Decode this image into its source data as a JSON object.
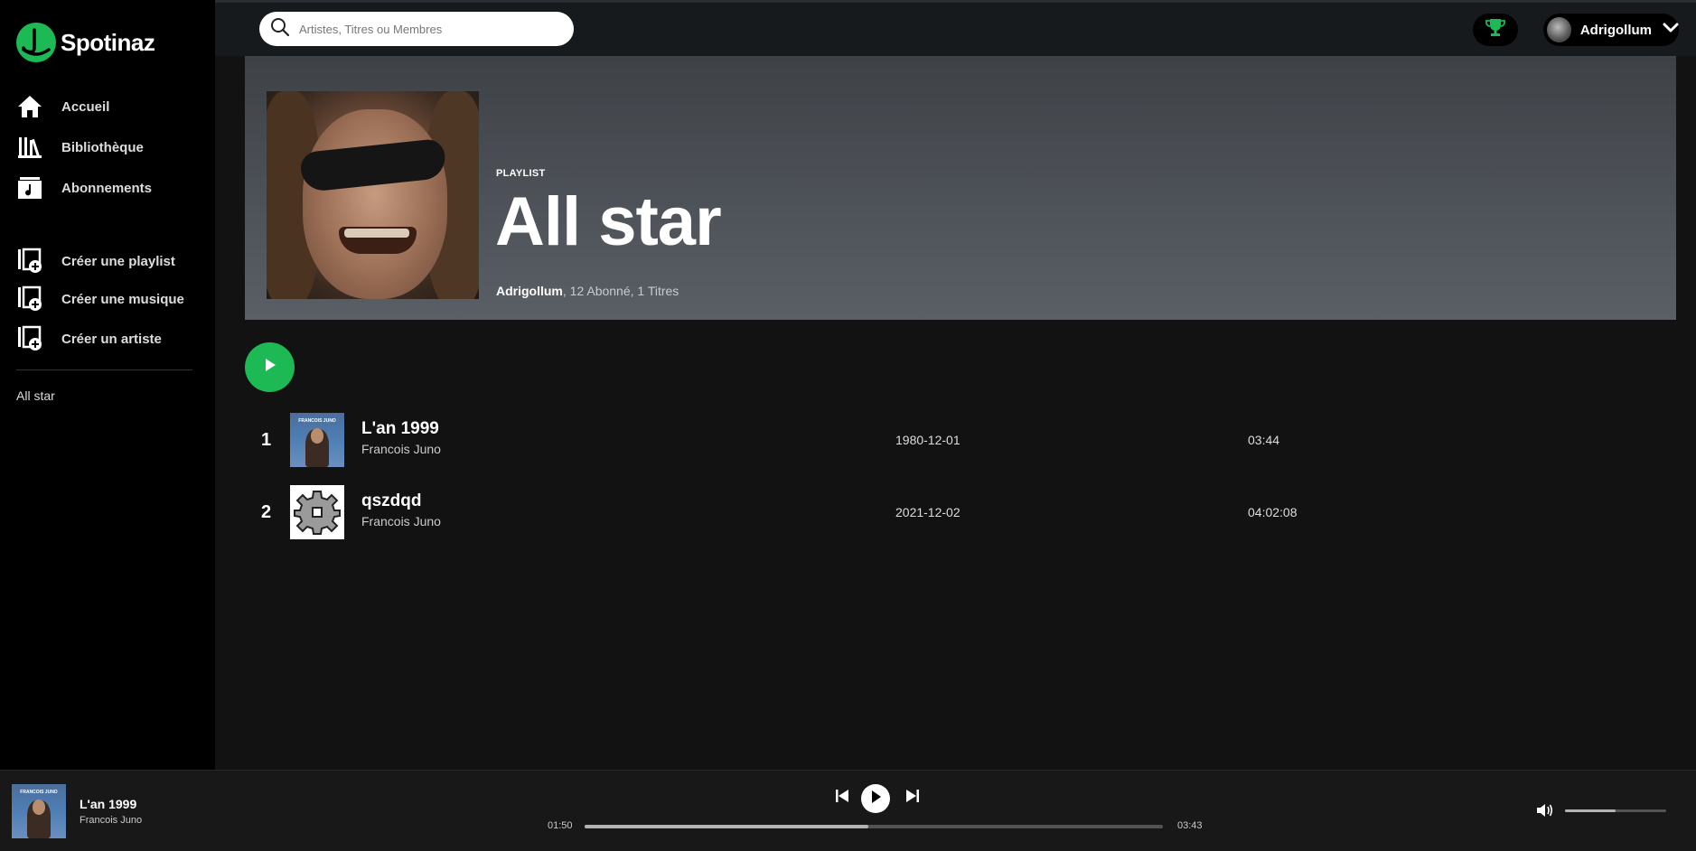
{
  "app": {
    "name": "Spotinaz",
    "brand_color": "#1db954"
  },
  "sidebar": {
    "nav": [
      {
        "label": "Accueil",
        "icon": "home-icon"
      },
      {
        "label": "Bibliothèque",
        "icon": "library-icon"
      },
      {
        "label": "Abonnements",
        "icon": "subscriptions-icon"
      }
    ],
    "create": [
      {
        "label": "Créer une playlist",
        "icon": "add-playlist-icon"
      },
      {
        "label": "Créer une musique",
        "icon": "add-music-icon"
      },
      {
        "label": "Créer un artiste",
        "icon": "add-artist-icon"
      }
    ],
    "playlists": [
      "All star"
    ]
  },
  "topbar": {
    "search_placeholder": "Artistes, Titres ou Membres",
    "trophy_icon": "trophy-icon",
    "user": {
      "name": "Adrigollum"
    }
  },
  "playlist": {
    "kicker": "PLAYLIST",
    "title": "All star",
    "owner": "Adrigollum",
    "meta": ", 12 Abonné, 1 Titres"
  },
  "tracks": [
    {
      "number": "1",
      "title": "L'an 1999",
      "artist": "Francois Juno",
      "date": "1980-12-01",
      "duration": "03:44",
      "cover_text": "FRANCOIS JUNO"
    },
    {
      "number": "2",
      "title": "qszdqd",
      "artist": "Francois Juno",
      "date": "2021-12-02",
      "duration": "04:02:08",
      "cover_icon": "gear-icon"
    }
  ],
  "player": {
    "title": "L'an 1999",
    "artist": "Francois Juno",
    "cover_text": "FRANCOIS JUNO",
    "current_time": "01:50",
    "total_time": "03:43",
    "progress_fraction": 0.49,
    "volume_fraction": 0.5
  }
}
